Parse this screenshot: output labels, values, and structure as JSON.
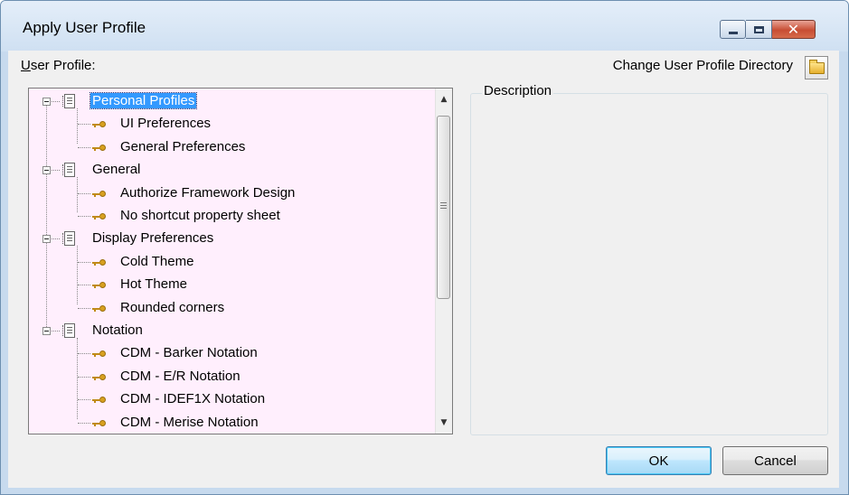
{
  "window": {
    "title": "Apply User Profile"
  },
  "labels": {
    "user_profile_underlined": "U",
    "user_profile_rest": "ser Profile:",
    "change_directory": "Change User Profile Directory",
    "description": "Description"
  },
  "tree": {
    "groups": [
      {
        "label": "Personal Profiles",
        "selected": true,
        "items": [
          "UI Preferences",
          "General Preferences"
        ]
      },
      {
        "label": "General",
        "selected": false,
        "items": [
          "Authorize Framework Design",
          "No shortcut property sheet"
        ]
      },
      {
        "label": "Display Preferences",
        "selected": false,
        "items": [
          "Cold Theme",
          "Hot Theme",
          "Rounded corners"
        ]
      },
      {
        "label": "Notation",
        "selected": false,
        "items": [
          "CDM - Barker Notation",
          "CDM - E/R Notation",
          "CDM - IDEF1X Notation",
          "CDM - Merise Notation"
        ]
      }
    ]
  },
  "buttons": {
    "ok": "OK",
    "cancel": "Cancel"
  },
  "colors": {
    "tree_background": "#ffeffd",
    "selection": "#3399ff"
  },
  "icons": {
    "minimize": "minimize-icon",
    "maximize": "maximize-icon",
    "close": "close-icon",
    "folder": "folder-icon",
    "profile": "profile-document-icon",
    "key": "key-icon"
  }
}
